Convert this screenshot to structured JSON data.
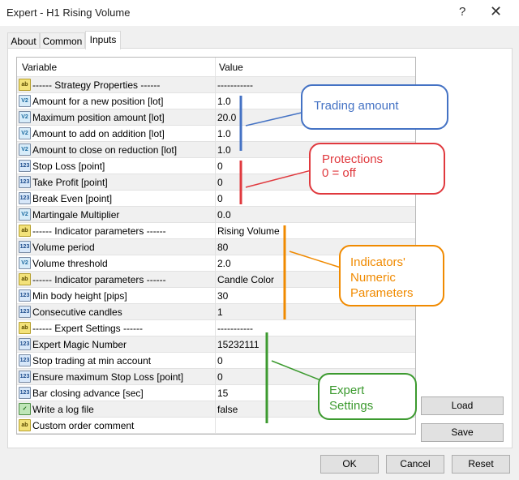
{
  "window": {
    "title": "Expert - H1 Rising Volume",
    "help_glyph": "?",
    "close_glyph": "✕"
  },
  "tabs": [
    {
      "label": "About"
    },
    {
      "label": "Common"
    },
    {
      "label": "Inputs",
      "active": true
    }
  ],
  "grid": {
    "col_variable": "Variable",
    "col_value": "Value",
    "rows": [
      {
        "type": "ab",
        "icon_text": "ab",
        "name": "------ Strategy Properties ------",
        "value": "-----------"
      },
      {
        "type": "dbl",
        "icon_text": "V2",
        "name": "Amount for a new position [lot]",
        "value": "1.0"
      },
      {
        "type": "dbl",
        "icon_text": "V2",
        "name": "Maximum position amount [lot]",
        "value": "20.0"
      },
      {
        "type": "dbl",
        "icon_text": "V2",
        "name": "Amount to add on addition [lot]",
        "value": "1.0"
      },
      {
        "type": "dbl",
        "icon_text": "V2",
        "name": "Amount to close on reduction [lot]",
        "value": "1.0"
      },
      {
        "type": "int",
        "icon_text": "123",
        "name": "Stop Loss [point]",
        "value": "0"
      },
      {
        "type": "int",
        "icon_text": "123",
        "name": "Take Profit [point]",
        "value": "0"
      },
      {
        "type": "int",
        "icon_text": "123",
        "name": "Break Even [point]",
        "value": "0"
      },
      {
        "type": "dbl",
        "icon_text": "V2",
        "name": "Martingale Multiplier",
        "value": "0.0"
      },
      {
        "type": "ab",
        "icon_text": "ab",
        "name": "------ Indicator parameters ------",
        "value": "Rising Volume"
      },
      {
        "type": "int",
        "icon_text": "123",
        "name": "Volume period",
        "value": "80"
      },
      {
        "type": "dbl",
        "icon_text": "V2",
        "name": "Volume threshold",
        "value": "2.0"
      },
      {
        "type": "ab",
        "icon_text": "ab",
        "name": "------ Indicator parameters ------",
        "value": "Candle Color"
      },
      {
        "type": "int",
        "icon_text": "123",
        "name": "Min body height [pips]",
        "value": "30"
      },
      {
        "type": "int",
        "icon_text": "123",
        "name": "Consecutive candles",
        "value": "1"
      },
      {
        "type": "ab",
        "icon_text": "ab",
        "name": "------ Expert Settings ------",
        "value": "-----------"
      },
      {
        "type": "int",
        "icon_text": "123",
        "name": "Expert Magic Number",
        "value": "15232111"
      },
      {
        "type": "int",
        "icon_text": "123",
        "name": "Stop trading at min account",
        "value": "0"
      },
      {
        "type": "int",
        "icon_text": "123",
        "name": "Ensure maximum Stop Loss [point]",
        "value": "0"
      },
      {
        "type": "int",
        "icon_text": "123",
        "name": "Bar closing advance [sec]",
        "value": "15"
      },
      {
        "type": "bool",
        "icon_text": "✓",
        "name": "Write a log file",
        "value": "false"
      },
      {
        "type": "ab",
        "icon_text": "ab",
        "name": "Custom order comment",
        "value": ""
      }
    ]
  },
  "buttons": {
    "load": "Load",
    "save": "Save",
    "ok": "OK",
    "cancel": "Cancel",
    "reset": "Reset"
  },
  "callouts": {
    "trading": {
      "lines": [
        "Trading amount"
      ],
      "color": "#4472c4"
    },
    "protections": {
      "lines": [
        "Protections",
        "0 = off"
      ],
      "color": "#e0393e"
    },
    "indicators": {
      "lines": [
        "Indicators'",
        "Numeric",
        "Parameters"
      ],
      "color": "#f08a00"
    },
    "expert": {
      "lines": [
        "Expert",
        "Settings"
      ],
      "color": "#3c9a2f"
    }
  }
}
